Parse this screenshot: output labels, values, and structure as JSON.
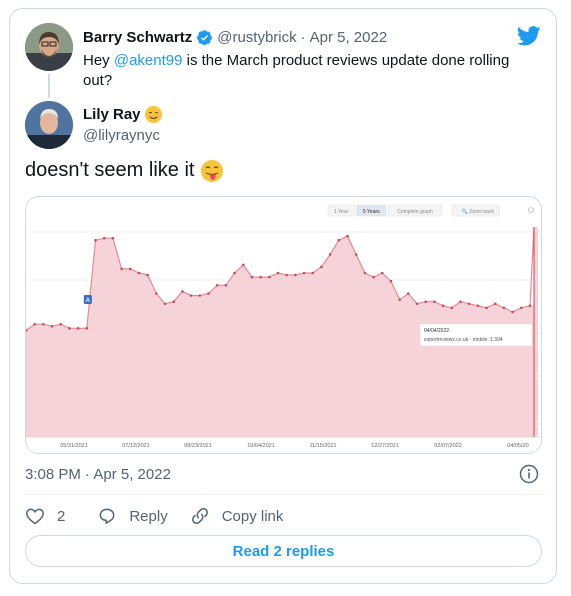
{
  "original_tweet": {
    "author_name": "Barry Schwartz",
    "author_handle": "@rustybrick",
    "separator": "·",
    "date": "Apr 5, 2022",
    "text_before": "Hey ",
    "mention": "@akent99",
    "text_after": " is the March product reviews update done rolling out?"
  },
  "reply_tweet": {
    "author_name": "Lily Ray",
    "author_handle": "@lilyraynyc",
    "text": "doesn't seem like it",
    "timestamp": "3:08 PM · Apr 5, 2022"
  },
  "chart": {
    "buttons": [
      "1 Year",
      "5 Years",
      "Complete graph"
    ],
    "active_button": "5 Years",
    "zoom_label": "Zoom back",
    "marker_label": "A",
    "tooltip_date": "04/04/2022",
    "tooltip_value": "expertreviews.co.uk - mobile: 1.394",
    "x_ticks": [
      "05/31/2021",
      "07/12/2021",
      "08/23/2021",
      "10/04/2021",
      "11/15/2021",
      "12/27/2021",
      "02/07/2022",
      "04/05/20"
    ],
    "fill_color": "#f6d3d8",
    "line_color": "#e58a96",
    "series": [
      0.52,
      0.55,
      0.55,
      0.54,
      0.55,
      0.53,
      0.53,
      0.53,
      0.96,
      0.97,
      0.97,
      0.82,
      0.82,
      0.8,
      0.79,
      0.7,
      0.65,
      0.66,
      0.71,
      0.69,
      0.69,
      0.7,
      0.74,
      0.74,
      0.8,
      0.84,
      0.78,
      0.78,
      0.78,
      0.8,
      0.79,
      0.79,
      0.8,
      0.8,
      0.83,
      0.89,
      0.96,
      0.98,
      0.89,
      0.8,
      0.78,
      0.8,
      0.76,
      0.67,
      0.7,
      0.65,
      0.66,
      0.66,
      0.64,
      0.63,
      0.66,
      0.65,
      0.64,
      0.63,
      0.65,
      0.63,
      0.61,
      0.63,
      0.64
    ]
  },
  "actions": {
    "like_count": "2",
    "reply_label": "Reply",
    "copy_label": "Copy link"
  },
  "read_replies": "Read 2 replies"
}
